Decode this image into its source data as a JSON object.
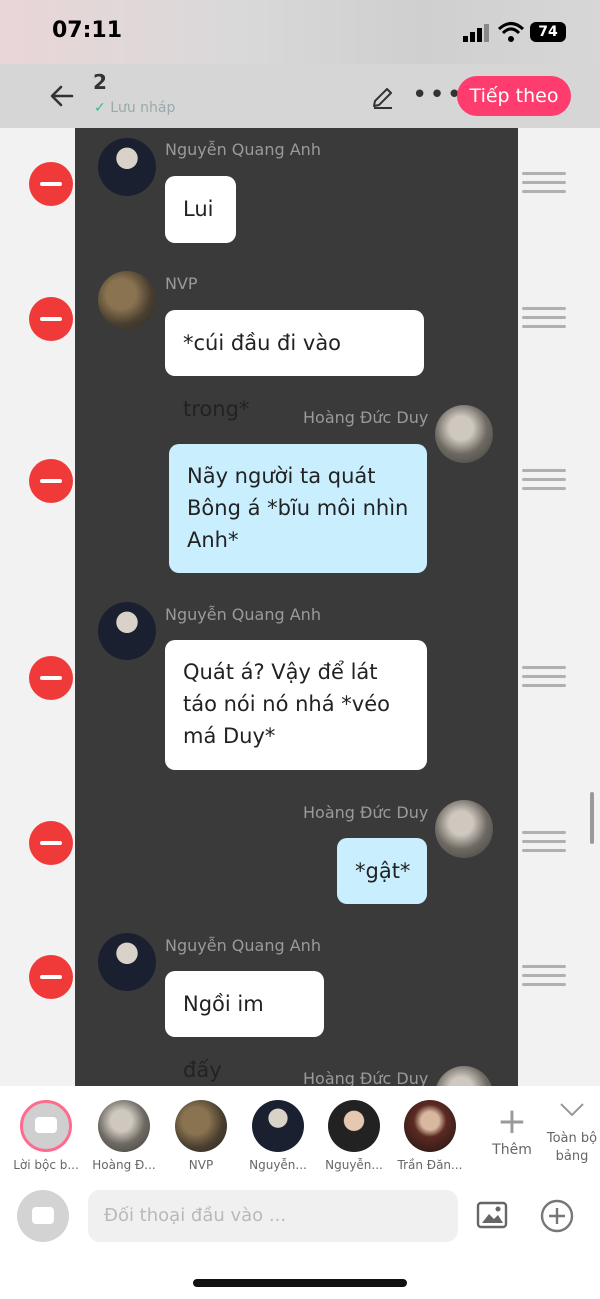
{
  "status": {
    "time": "07:11",
    "battery": "74"
  },
  "header": {
    "count": "2",
    "saved": "Lưu nháp",
    "next": "Tiếp theo"
  },
  "messages": [
    {
      "name": "Nguyễn Quang Anh",
      "text": "Lui",
      "side": "left"
    },
    {
      "name": "NVP",
      "text": "*cúi đầu đi vào trong*",
      "side": "left"
    },
    {
      "name": "Hoàng Đức Duy",
      "text": "Nãy người ta quát Bông á *bĩu môi nhìn Anh*",
      "side": "right"
    },
    {
      "name": "Nguyễn Quang Anh",
      "text": "Quát á? Vậy để lát táo nói nó nhá *véo má Duy*",
      "side": "left"
    },
    {
      "name": "Hoàng Đức Duy",
      "text": "*gật*",
      "side": "right"
    },
    {
      "name": "Nguyễn Quang Anh",
      "text": "Ngồi im đấy",
      "side": "left"
    },
    {
      "name": "Hoàng Đức Duy",
      "text": "",
      "side": "right"
    }
  ],
  "characters": [
    {
      "label": "Lời bộc b...",
      "icon": "narration-icon"
    },
    {
      "label": "Hoàng Đ..."
    },
    {
      "label": "NVP"
    },
    {
      "label": "Nguyễn..."
    },
    {
      "label": "Nguyễn..."
    },
    {
      "label": "Trần Đăn..."
    }
  ],
  "tools": {
    "more": "Thêm",
    "all": "Toàn bộ bảng"
  },
  "input": {
    "placeholder": "Đối thoại đầu vào ..."
  },
  "colors": {
    "accent": "#ff3c6e",
    "delete": "#f03a3a",
    "bubble_blue": "#c9efff",
    "feed_bg": "#3a3a3a"
  }
}
